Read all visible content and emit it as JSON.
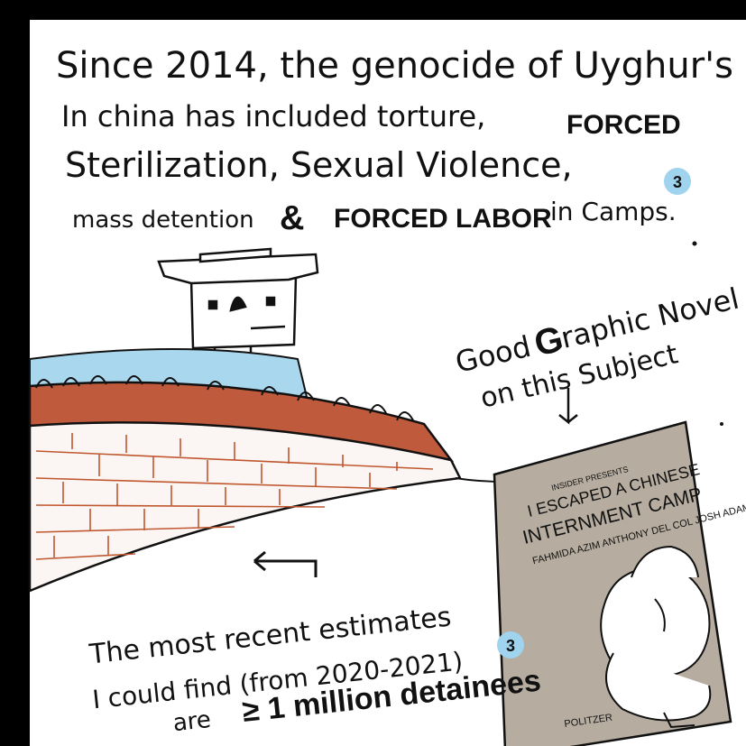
{
  "caption": {
    "line1": "Since 2014, the genocide of Uyghur's",
    "line2": "In china has included torture,",
    "line2_caps": "FORCED",
    "line3": "Sterilization, Sexual Violence,",
    "line4_a": "mass detention",
    "line4_amp": "&",
    "line4_caps": "FORCED LABOR",
    "line4_b": "in Camps.",
    "citation": "3"
  },
  "recommendation": {
    "line1_a": "Good",
    "line1_g": "G",
    "line1_b": "raphic Novel",
    "line2": "on this Subject"
  },
  "book": {
    "presenter": "INSIDER PRESENTS",
    "title_1": "I ESCAPED A CHINESE",
    "title_2": "INTERNMENT CAMP",
    "authors": "FAHMIDA AZIM   ANTHONY DEL COL   JOSH ADAMS",
    "imprint": "POLITZER"
  },
  "estimate": {
    "line1": "The most recent estimates",
    "line2": "I could find (from 2020-2021)",
    "line3_a": "are",
    "line3_b": "≥ 1 million detainees",
    "citation": "3"
  },
  "colors": {
    "border": "#000000",
    "paper": "#ffffff",
    "roof": "#bf5a3c",
    "sky": "#a9d8ee",
    "brick": "#c0572f",
    "wall": "#fbf6f4",
    "book": "#b6ada0",
    "badge": "#9fd3ee"
  }
}
